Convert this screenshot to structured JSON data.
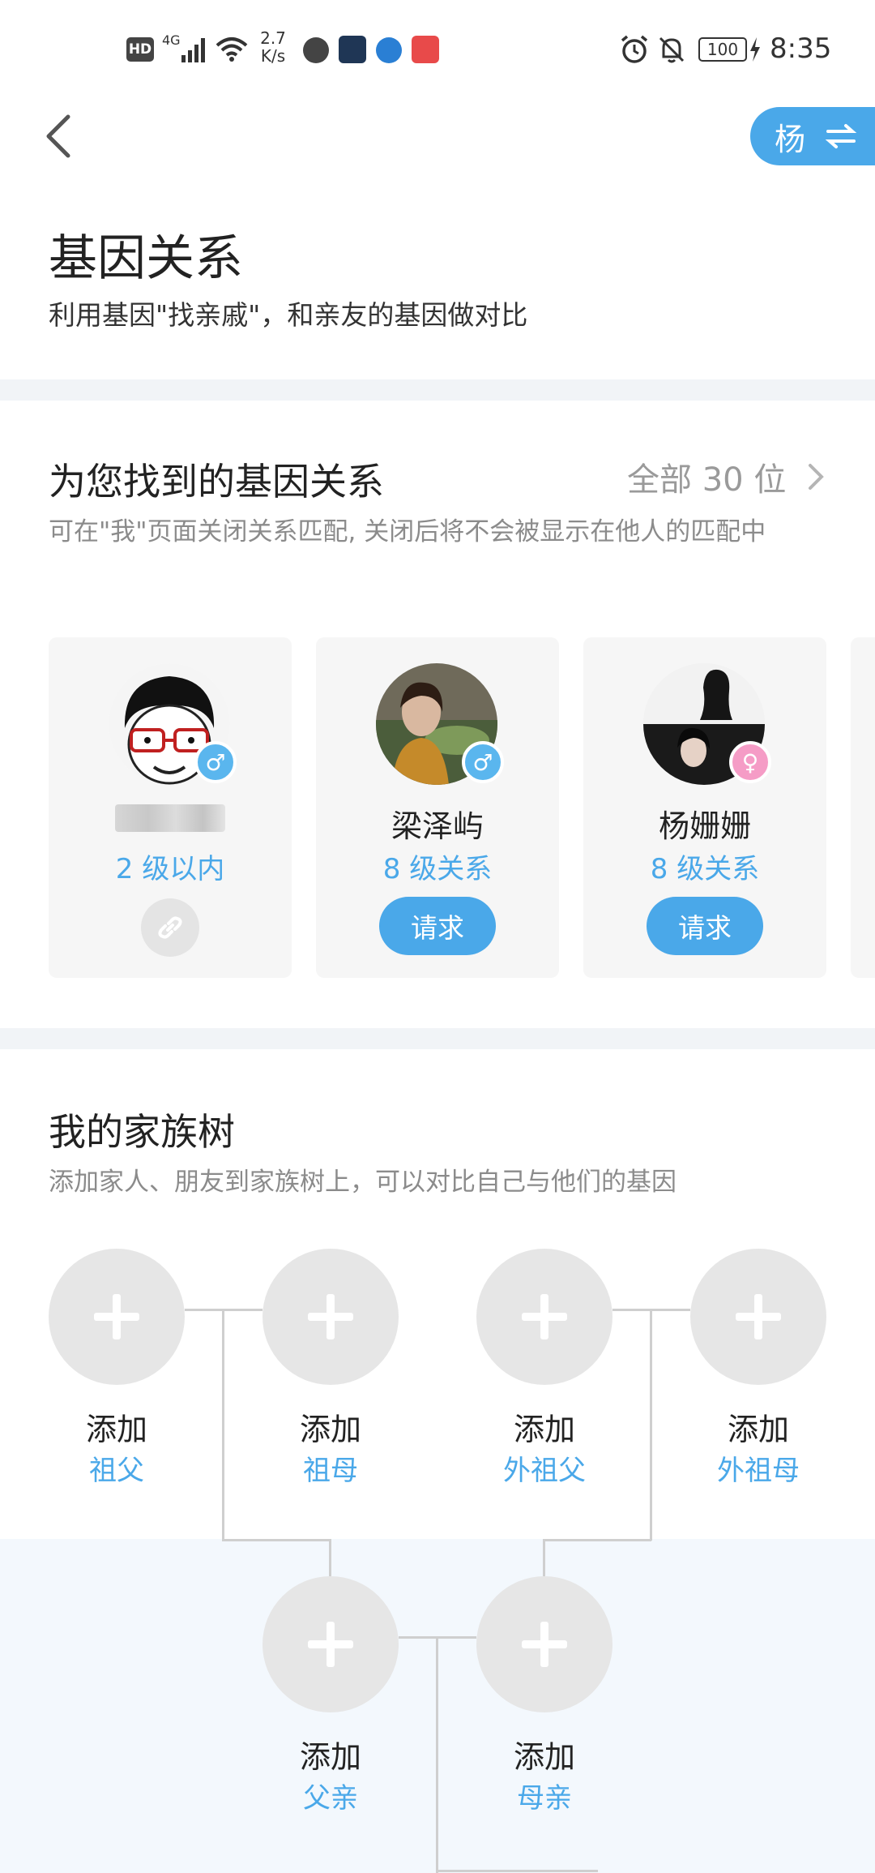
{
  "status_bar": {
    "hd": "HD",
    "network": "4G",
    "speed_value": "2.7",
    "speed_unit": "K/s",
    "battery": "100",
    "time": "8:35"
  },
  "header": {
    "back_icon": "chevron-left-icon",
    "profile_initial": "杨",
    "switch_icon": "swap-arrows-icon",
    "title": "基因关系",
    "subtitle": "利用基因\"找亲戚\"，和亲友的基因做对比"
  },
  "matches": {
    "title": "为您找到的基因关系",
    "all_label": "全部 30 位",
    "description": "可在\"我\"页面关闭关系匹配, 关闭后将不会被显示在他人的匹配中",
    "cards": [
      {
        "name": "",
        "level": "2 级以内",
        "gender": "male",
        "action": "link"
      },
      {
        "name": "梁泽屿",
        "level": "8 级关系",
        "gender": "male",
        "action_label": "请求"
      },
      {
        "name": "杨姗姗",
        "level": "8 级关系",
        "gender": "female",
        "action_label": "请求"
      }
    ]
  },
  "family_tree": {
    "title": "我的家族树",
    "description": "添加家人、朋友到家族树上，可以对比自己与他们的基因",
    "members": [
      {
        "add": "添加",
        "role": "祖父"
      },
      {
        "add": "添加",
        "role": "祖母"
      },
      {
        "add": "添加",
        "role": "外祖父"
      },
      {
        "add": "添加",
        "role": "外祖母"
      },
      {
        "add": "添加",
        "role": "父亲"
      },
      {
        "add": "添加",
        "role": "母亲"
      }
    ]
  },
  "colors": {
    "accent": "#4aa8e9",
    "female": "#f59cc6",
    "male": "#5ab6ee"
  }
}
